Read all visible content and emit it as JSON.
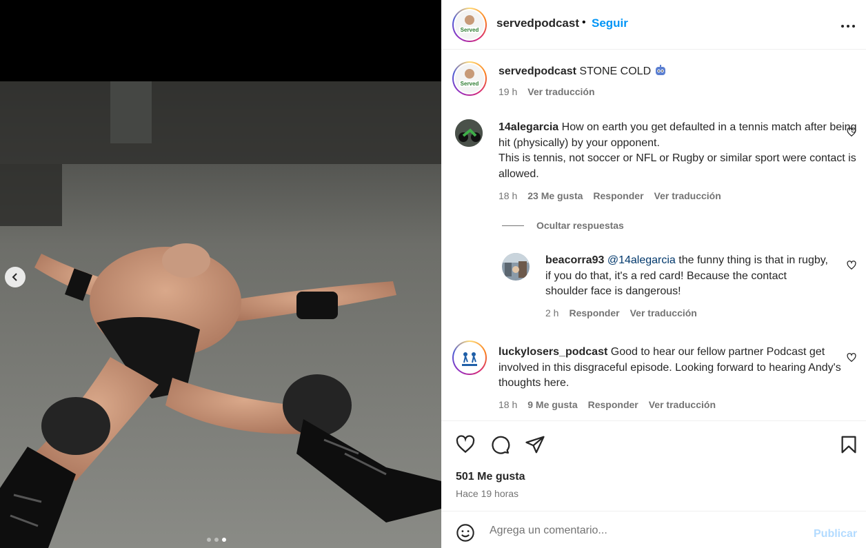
{
  "post": {
    "author": "servedpodcast",
    "separator": "•",
    "follow_label": "Seguir",
    "avatar_text": "Served"
  },
  "caption": {
    "username": "servedpodcast",
    "text": "STONE COLD",
    "emoji": "robot-face-icon",
    "time": "19 h",
    "translate": "Ver traducción"
  },
  "comments": [
    {
      "username": "14alegarcia",
      "text_line1": "How on earth you get defaulted in a tennis match after being hit (physically) by your opponent.",
      "text_line2": "This is tennis, not soccer or NFL or Rugby or similar sport were contact is allowed.",
      "time": "18 h",
      "likes": "23 Me gusta",
      "reply": "Responder",
      "translate": "Ver traducción"
    }
  ],
  "replies_toggle": "Ocultar respuestas",
  "reply": {
    "username": "beacorra93",
    "mention": "@14alegarcia",
    "text": "the funny thing is that in rugby, if you do that, it's a red card! Because the contact shoulder face is dangerous!",
    "time": "2 h",
    "reply": "Responder",
    "translate": "Ver traducción"
  },
  "comment2": {
    "username": "luckylosers_podcast",
    "text": "Good to hear our fellow partner Podcast get involved in this disgraceful episode. Looking forward to hearing Andy's thoughts here.",
    "time": "18 h",
    "likes": "9 Me gusta",
    "reply": "Responder",
    "translate": "Ver traducción"
  },
  "likes_count": "501 Me gusta",
  "posted_ago": "Hace 19 horas",
  "composer": {
    "placeholder": "Agrega un comentario...",
    "post_label": "Publicar"
  },
  "carousel": {
    "total": 3,
    "active_index": 2
  },
  "colors": {
    "link_blue": "#0095f6",
    "post_disabled": "#b3dbff",
    "secondary_text": "#737373"
  }
}
